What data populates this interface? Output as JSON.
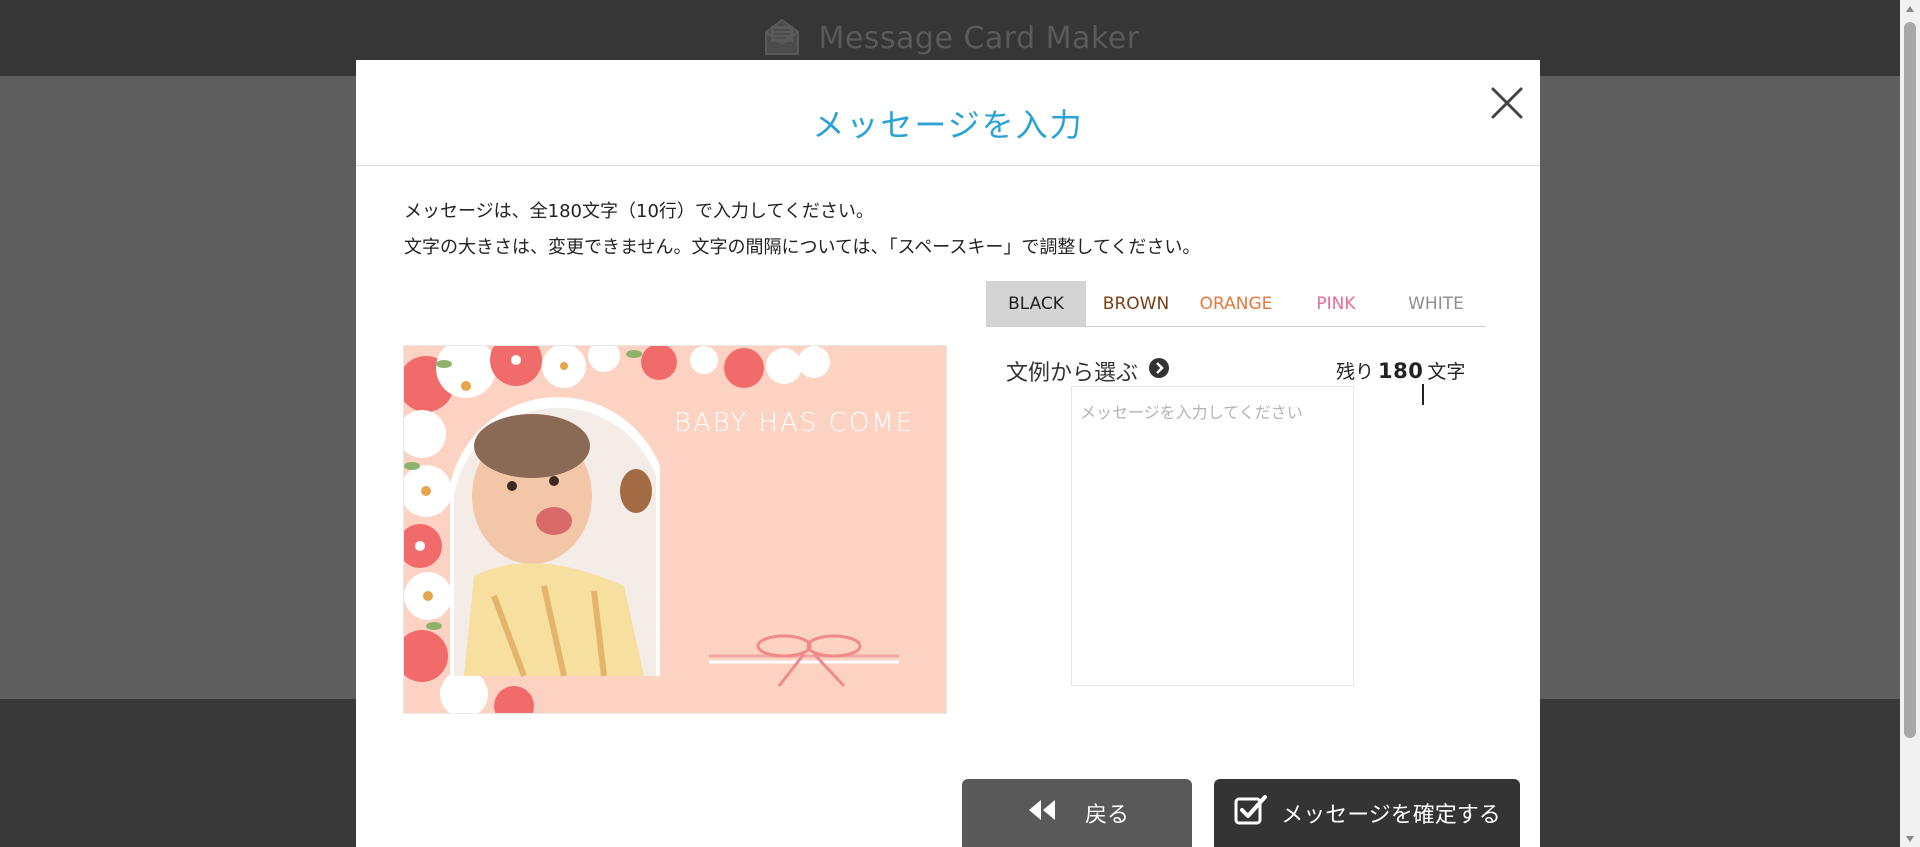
{
  "app": {
    "title": "Message Card Maker",
    "icon": "envelope-icon"
  },
  "modal": {
    "title": "メッセージを入力",
    "close_icon": "close-icon",
    "instructions": [
      "メッセージは、全180文字（10行）で入力してください。",
      "文字の大きさは、変更できません。文字の間隔については、「スペースキー」で調整してください。"
    ]
  },
  "card": {
    "text": "BABY HAS COME"
  },
  "color_tabs": [
    {
      "label": "BLACK",
      "color": "#222222",
      "active": true
    },
    {
      "label": "BROWN",
      "color": "#7a3d12",
      "active": false
    },
    {
      "label": "ORANGE",
      "color": "#e5793c",
      "active": false
    },
    {
      "label": "PINK",
      "color": "#e86c9a",
      "active": false
    },
    {
      "label": "WHITE",
      "color": "#8f8f8f",
      "active": false
    }
  ],
  "editor": {
    "example_link": "文例から選ぶ",
    "example_icon": "chevron-right-circle-icon",
    "remaining_prefix": "残り",
    "remaining_count": "180",
    "remaining_suffix": "文字",
    "placeholder": "メッセージを入力してください",
    "value": ""
  },
  "buttons": {
    "back_label": "戻る",
    "back_icon": "double-chevron-left-icon",
    "confirm_label": "メッセージを確定する",
    "confirm_icon": "checkbox-checked-icon"
  },
  "colors": {
    "accent": "#29a3d6",
    "card_background": "#fcd2c2",
    "button_back": "#595959",
    "button_confirm": "#343434"
  }
}
